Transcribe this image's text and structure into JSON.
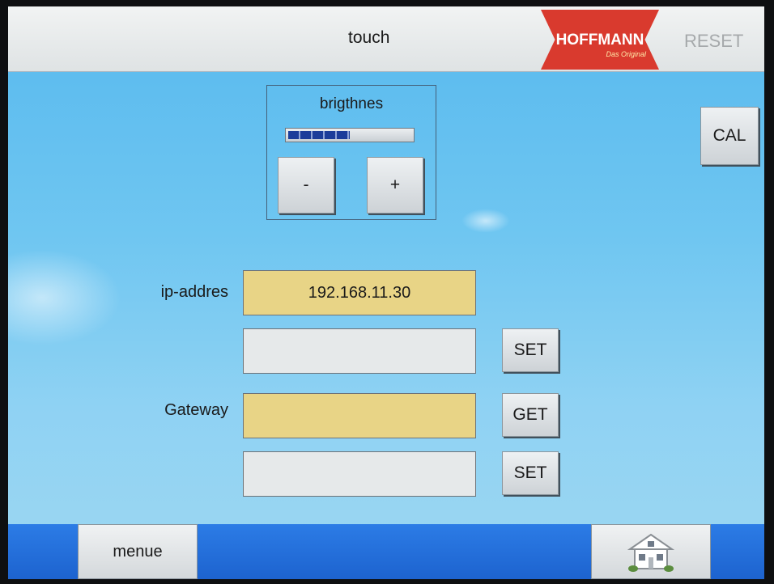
{
  "header": {
    "title": "touch",
    "logo_text": "HOFFMANN",
    "logo_tagline": "Das Original",
    "reset_label": "RESET"
  },
  "brightness": {
    "label": "brigthnes",
    "level_fraction": 0.5,
    "minus_label": "-",
    "plus_label": "+"
  },
  "cal_label": "CAL",
  "network": {
    "ip_label": "ip-addres",
    "ip_value": "192.168.11.30",
    "ip_input_value": "",
    "ip_set_label": "SET",
    "gateway_label": "Gateway",
    "gateway_value": "",
    "gateway_get_label": "GET",
    "gateway_input_value": "",
    "gateway_set_label": "SET"
  },
  "footer": {
    "menue_label": "menue",
    "home_icon": "house-icon"
  },
  "colors": {
    "background": "#6fc6f1",
    "field_yellow": "#e8d486",
    "field_grey": "#e6e9ea",
    "footer_blue": "#1d63cf",
    "logo_red": "#d93a2e",
    "bar_fill": "#1c3d9a"
  }
}
